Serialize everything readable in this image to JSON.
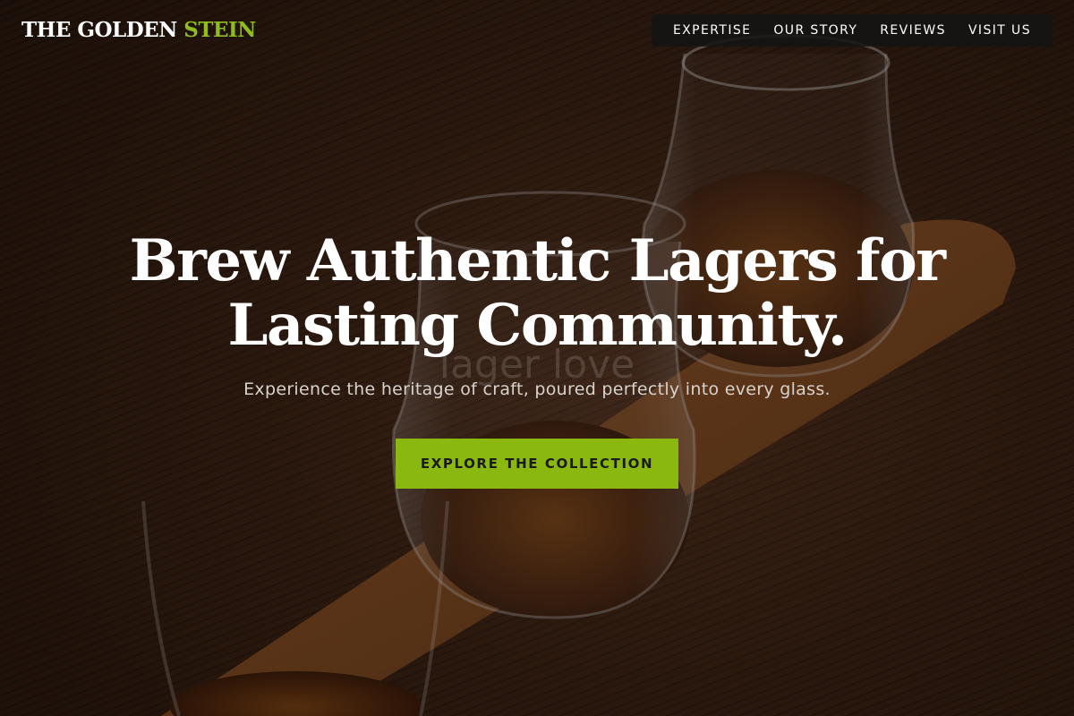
{
  "brand": {
    "name_main": "THE GOLDEN",
    "name_accent": "STEIN"
  },
  "nav": {
    "items": [
      {
        "label": "EXPERTISE"
      },
      {
        "label": "OUR STORY"
      },
      {
        "label": "REVIEWS"
      },
      {
        "label": "VISIT US"
      }
    ]
  },
  "hero": {
    "headline_line1": "Brew Authentic Lagers for",
    "headline_line2": "Lasting Community.",
    "background_text": "lager love",
    "subtitle": "Experience the heritage of craft, poured perfectly into every glass.",
    "cta_label": "EXPLORE THE COLLECTION"
  },
  "colors": {
    "accent": "#8ab80f",
    "brand_accent": "#8fbc1e",
    "nav_bg": "#141414"
  }
}
